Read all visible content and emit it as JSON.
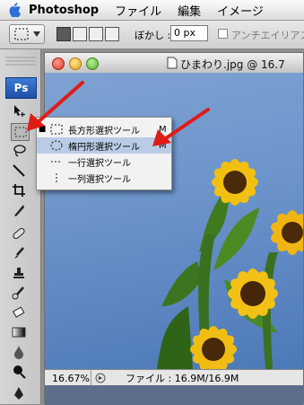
{
  "menubar": {
    "apple_icon": "apple-logo-icon",
    "app_name": "Photoshop",
    "items": [
      "ファイル",
      "編集",
      "イメージ"
    ]
  },
  "options_bar": {
    "feather_label": "ぼかし :",
    "feather_value": "0 px",
    "antialias_label": "アンチエイリアス"
  },
  "toolbox": {
    "badge": "Ps"
  },
  "document": {
    "title": "ひまわり.jpg @ 16.7",
    "zoom": "16.67%",
    "file_info": "ファイル : 16.9M/16.9M"
  },
  "tool_flyout": {
    "items": [
      {
        "label": "長方形選択ツール",
        "shortcut": "M",
        "current": true
      },
      {
        "label": "楕円形選択ツール",
        "shortcut": "M",
        "current": false
      },
      {
        "label": "一行選択ツール",
        "shortcut": "",
        "current": false
      },
      {
        "label": "一列選択ツール",
        "shortcut": "",
        "current": false
      }
    ]
  },
  "colors": {
    "annotation_arrow": "#e01c17",
    "ps_badge": "#2a5fbf",
    "menu_highlight": "#b9cbe6",
    "sky": "#6b93ca"
  }
}
